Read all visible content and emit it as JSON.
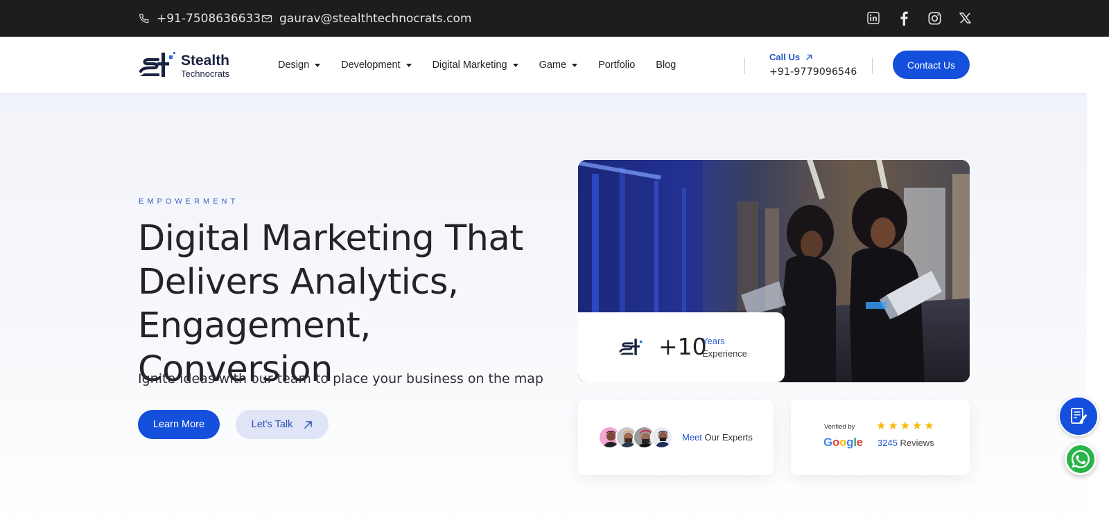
{
  "topbar": {
    "phone": "+91-7508636633",
    "email": "gaurav@stealthtechnocrats.com",
    "socials": [
      "linkedin-icon",
      "facebook-icon",
      "instagram-icon",
      "x-icon"
    ]
  },
  "brand": {
    "name_line1": "Stealth",
    "name_line2": "Technocrats"
  },
  "nav": {
    "items": [
      {
        "label": "Design",
        "dropdown": true
      },
      {
        "label": "Development",
        "dropdown": true
      },
      {
        "label": "Digital Marketing",
        "dropdown": true
      },
      {
        "label": "Game",
        "dropdown": true
      },
      {
        "label": "Portfolio",
        "dropdown": false
      },
      {
        "label": "Blog",
        "dropdown": false
      }
    ],
    "call_label": "Call Us",
    "call_number": "+91-9779096546",
    "contact_button": "Contact Us"
  },
  "hero": {
    "eyebrow": "EMPOWERMENT",
    "headline": "Digital Marketing That Delivers Analytics, Engagement, Conversion",
    "subtext": "Ignite ideas with our team to place your business on the map",
    "learn_more": "Learn More",
    "lets_talk": "Let's Talk"
  },
  "experience": {
    "value": "+10",
    "years_label": "Years",
    "experience_label": "Experience"
  },
  "experts": {
    "meet": "Meet",
    "rest": "Our Experts"
  },
  "reviews": {
    "verified_by": "Verified by",
    "google": "Google",
    "stars": 5,
    "count": "3245",
    "count_label": "Reviews"
  },
  "colors": {
    "accent": "#1450dc",
    "topbar_bg": "#1d1d1d",
    "star": "#f6b800",
    "whatsapp": "#29b44a"
  }
}
